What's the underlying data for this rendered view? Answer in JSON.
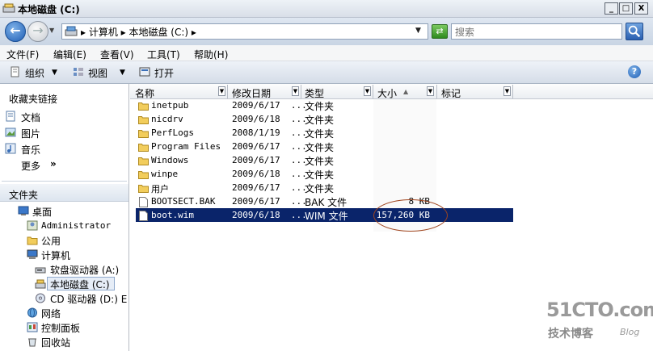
{
  "window": {
    "title": "本地磁盘 (C:)",
    "minimize": "_",
    "maximize": "□",
    "close": "X"
  },
  "address": {
    "path": "▸ 计算机 ▸ 本地磁盘 (C:) ▸",
    "search_placeholder": "搜索"
  },
  "menu": [
    "文件(F)",
    "编辑(E)",
    "查看(V)",
    "工具(T)",
    "帮助(H)"
  ],
  "toolbar": {
    "organize": "组织",
    "views": "视图",
    "open": "打开",
    "help": "?"
  },
  "favorites": {
    "header": "收藏夹链接",
    "items": [
      "文档",
      "图片",
      "音乐"
    ],
    "more": "更多",
    "more_arrow": "»"
  },
  "folders": {
    "header": "文件夹",
    "tree": [
      "桌面",
      "Administrator",
      "公用",
      "计算机",
      "软盘驱动器 (A:)",
      "本地磁盘 (C:)",
      "CD 驱动器 (D:) E",
      "网络",
      "控制面板",
      "回收站"
    ]
  },
  "columns": [
    "名称",
    "修改日期",
    "类型",
    "大小",
    "标记"
  ],
  "files": [
    {
      "name": "inetpub",
      "date": "2009/6/17  ...",
      "type": "文件夹",
      "size": "",
      "icon": "folder-icon"
    },
    {
      "name": "nicdrv",
      "date": "2009/6/18  ...",
      "type": "文件夹",
      "size": "",
      "icon": "folder-icon"
    },
    {
      "name": "PerfLogs",
      "date": "2008/1/19  ...",
      "type": "文件夹",
      "size": "",
      "icon": "folder-icon"
    },
    {
      "name": "Program Files",
      "date": "2009/6/17  ...",
      "type": "文件夹",
      "size": "",
      "icon": "folder-icon"
    },
    {
      "name": "Windows",
      "date": "2009/6/17  ...",
      "type": "文件夹",
      "size": "",
      "icon": "folder-icon"
    },
    {
      "name": "winpe",
      "date": "2009/6/18  ...",
      "type": "文件夹",
      "size": "",
      "icon": "folder-icon"
    },
    {
      "name": "用户",
      "date": "2009/6/17  ...",
      "type": "文件夹",
      "size": "",
      "icon": "folder-icon"
    },
    {
      "name": "BOOTSECT.BAK",
      "date": "2009/6/17  ...",
      "type": "BAK 文件",
      "size": "8 KB",
      "icon": "file-icon"
    },
    {
      "name": "boot.wim",
      "date": "2009/6/18  ...",
      "type": "WIM 文件",
      "size": "157,260 KB",
      "icon": "file-icon"
    }
  ],
  "watermark": {
    "logo": "51CTO.com",
    "sub": "技术博客",
    "blog": "Blog"
  }
}
